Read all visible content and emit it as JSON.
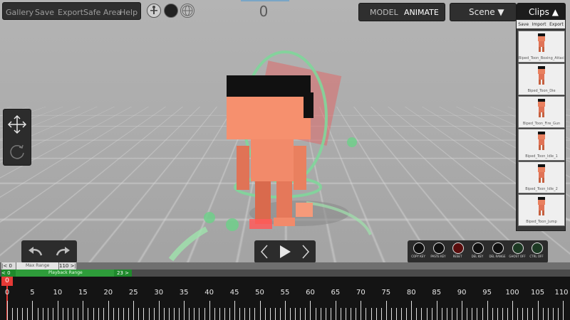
{
  "menu": {
    "items": [
      "Gallery",
      "Save",
      "Export",
      "Safe Area",
      "Help"
    ]
  },
  "frame_counter": "0",
  "modes": {
    "model": "MODEL",
    "animate": "ANIMATE",
    "active": "ANIMATE"
  },
  "scene_label": "Scene ▼",
  "clips_label": "Clips ▲",
  "clips": {
    "tabs": [
      "Save",
      "Import",
      "Export"
    ],
    "items": [
      "Biped_Toon_Boxing_Attack",
      "Biped_Toon_Die",
      "Biped_Toon_Fire_Gun",
      "Biped_Toon_Idle_1",
      "Biped_Toon_Idle_2",
      "Biped_Toon_Jump"
    ]
  },
  "key_tools": [
    {
      "label": "COPY KEY",
      "icon": "copy-icon"
    },
    {
      "label": "PASTE KEY",
      "icon": "paste-icon"
    },
    {
      "label": "RESET",
      "icon": "reset-icon"
    },
    {
      "label": "DEL KEY",
      "icon": "del-key-icon"
    },
    {
      "label": "DEL RANGE",
      "icon": "del-range-icon"
    },
    {
      "label": "GHOST OFF",
      "icon": "ghost-icon"
    },
    {
      "label": "CTRL OFF",
      "icon": "ctrl-icon"
    }
  ],
  "max_range": {
    "start": "|< 0",
    "label": "Max Range",
    "end": "110 >|"
  },
  "playback_range": {
    "start": "< 0",
    "label": "Playback Range",
    "end": "23 >"
  },
  "playhead": "0",
  "timeline": {
    "labels": [
      "0",
      "5",
      "10",
      "15",
      "20",
      "25",
      "30",
      "35",
      "40",
      "45",
      "50",
      "55",
      "60",
      "65",
      "70",
      "75",
      "80",
      "85",
      "90",
      "95",
      "100",
      "105",
      "110"
    ],
    "max": 110,
    "current_frame": 0,
    "playback_end": 23
  },
  "colors": {
    "accent_red": "#e53935",
    "playback_green": "#2e9c3a",
    "character_skin": "#f28a6a",
    "hair": "#111111",
    "ring_green": "#7fd69a"
  }
}
